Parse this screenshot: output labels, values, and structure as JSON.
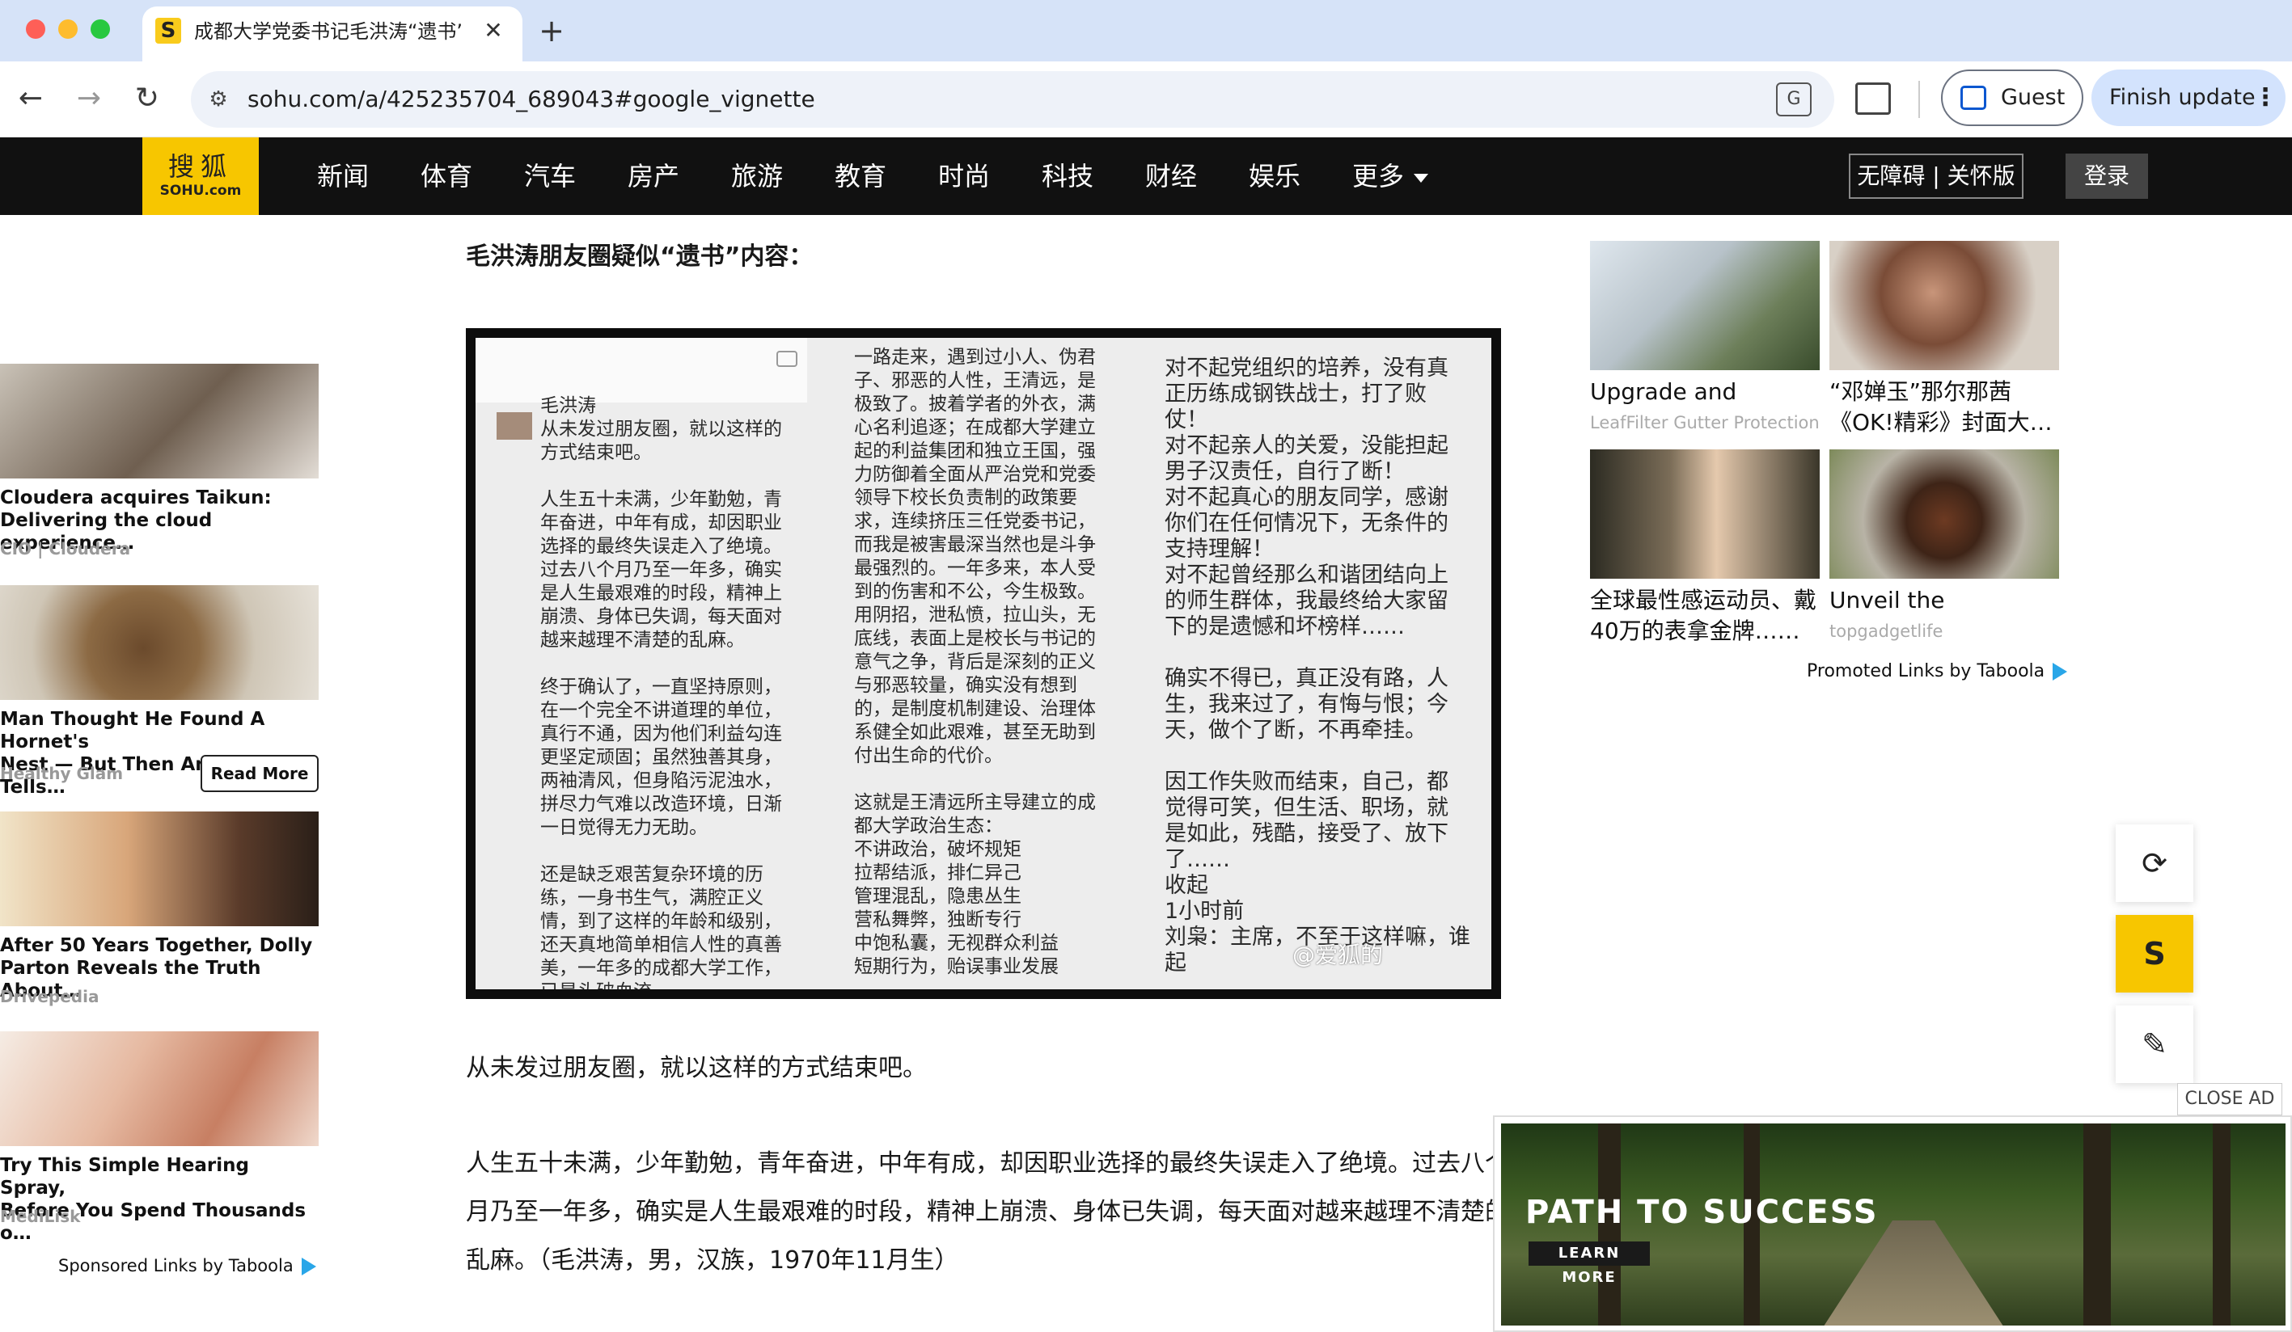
{
  "browser": {
    "tab_title": "成都大学党委书记毛洪涛“遗书”",
    "tab_close": "✕",
    "new_tab": "+",
    "url": "sohu.com/a/425235704_689043#google_vignette",
    "guest_label": "Guest",
    "finish_update_label": "Finish update",
    "kebab": "⋮",
    "back": "←",
    "forward": "→",
    "reload": "↻"
  },
  "sohu_nav": {
    "logo_cn": "搜狐",
    "logo_en": "SOHU.com",
    "items": [
      "新闻",
      "体育",
      "汽车",
      "房产",
      "旅游",
      "教育",
      "时尚",
      "科技",
      "财经",
      "娱乐",
      "更多"
    ],
    "accessibility": "无障碍 | 关怀版",
    "login": "登录"
  },
  "article": {
    "heading": "毛洪涛朋友圈疑似“遗书”内容：",
    "screenshot": {
      "col1": "毛洪涛\n从未发过朋友圈，就以这样的\n方式结束吧。\n\n人生五十未满，少年勤勉，青\n年奋进，中年有成，却因职业\n选择的最终失误走入了绝境。\n过去八个月乃至一年多，确实\n是人生最艰难的时段，精神上\n崩溃、身体已失调，每天面对\n越来越理不清楚的乱麻。\n\n终于确认了，一直坚持原则，\n在一个完全不讲道理的单位，\n真行不通，因为他们利益勾连\n更坚定顽固；虽然独善其身，\n两袖清风，但身陷污泥浊水，\n拼尽力气难以改造环境，日渐\n一日觉得无力无助。\n\n还是缺乏艰苦复杂环境的历\n练，一身书生气，满腔正义\n情，到了这样的年龄和级别，\n还天真地简单相信人性的真善\n美，一年多的成都大学工作，\n已是头破血流。",
      "col2": "一路走来，遇到过小人、伪君\n子、邪恶的人性，王清远，是\n极致了。披着学者的外衣，满\n心名利追逐；在成都大学建立\n起的利益集团和独立王国，强\n力防御着全面从严治党和党委\n领导下校长负责制的政策要\n求，连续挤压三任党委书记，\n而我是被害最深当然也是斗争\n最强烈的。一年多来，本人受\n到的伤害和不公，今生极致。\n用阴招，泄私愤，拉山头，无\n底线，表面上是校长与书记的\n意气之争，背后是深刻的正义\n与邪恶较量，确实没有想到\n的，是制度机制建设、治理体\n系健全如此艰难，甚至无助到\n付出生命的代价。\n\n这就是王清远所主导建立的成\n都大学政治生态：\n不讲政治，破坏规矩\n拉帮结派，排仁异己\n管理混乱，隐患丛生\n营私舞弊，独断专行\n中饱私囊，无视群众利益\n短期行为，贻误事业发展",
      "col3": "对不起党组织的培养，没有真\n正历练成钢铁战士，打了败\n仗！\n对不起亲人的关爱，没能担起\n男子汉责任，自行了断！\n对不起真心的朋友同学，感谢\n你们在任何情况下，无条件的\n支持理解！\n对不起曾经那么和谐团结向上\n的师生群体，我最终给大家留\n下的是遗憾和坏榜样……\n\n确实不得已，真正没有路，人\n生，我来过了，有悔与恨；今\n天，做个了断，不再牵挂。\n\n因工作失败而结束，自己，都\n觉得可笑，但生活、职场，就\n是如此，残酷，接受了、放下\n了……\n收起\n1小时前\n刘枭：主席，不至于这样嘛，谁起",
      "watermark": "@爱狐的"
    },
    "para1": "从未发过朋友圈，就以这样的方式结束吧。",
    "para2": "人生五十未满，少年勤勉，青年奋进，中年有成，却因职业选择的最终失误走入了绝境。过去八个月乃至一年多，确实是人生最艰难的时段，精神上崩溃、身体已失调，每天面对越来越理不清楚的乱麻。（毛洪涛，男，汉族，1970年11月生）"
  },
  "left_ads": {
    "items": [
      {
        "title": "Cloudera acquires Taikun:\nDelivering the cloud experience…",
        "source": "CIO | Cloudera"
      },
      {
        "title": "Man Thought He Found A Hornet's\nNest — But Then An Expert Tells…",
        "source": "Healthy Glam",
        "cta": "Read More"
      },
      {
        "title": "After 50 Years Together, Dolly\nParton Reveals the Truth About…",
        "source": "Drivepedia"
      },
      {
        "title": "Try This Simple Hearing Spray,\nBefore You Spend Thousands o…",
        "source": "MediLisk"
      }
    ],
    "sponsored": "Sponsored Links by Taboola"
  },
  "right_ads": {
    "items": [
      {
        "title": "Upgrade and prote…",
        "source": "LeafFilter Gutter Protection"
      },
      {
        "title": "“邓婵玉”那尔那茜\n《OK!精彩》封面大…",
        "source": ""
      },
      {
        "title": "全球最性感运动员、戴\n40万的表拿金牌……",
        "source": ""
      },
      {
        "title": "Unveil the Mystical…",
        "source": "topgadgetlife"
      }
    ],
    "promoted": "Promoted Links by Taboola"
  },
  "side_buttons": {
    "refresh": "⟳",
    "sohu": "S",
    "edit": "✎"
  },
  "bottom_ad": {
    "close": "CLOSE AD",
    "title": "PATH TO SUCCESS",
    "cta": "LEARN MORE"
  }
}
